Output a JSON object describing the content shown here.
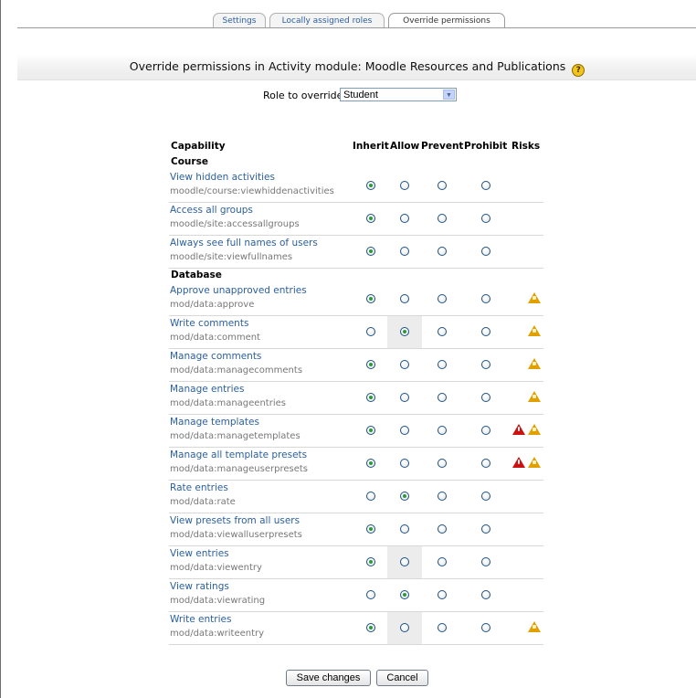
{
  "tabs": [
    {
      "label": "Settings",
      "active": false
    },
    {
      "label": "Locally assigned roles",
      "active": false
    },
    {
      "label": "Override permissions",
      "active": true
    }
  ],
  "header": {
    "title": "Override permissions in Activity module: Moodle Resources and Publications"
  },
  "role": {
    "label": "Role to override",
    "selected": "Student"
  },
  "columns": {
    "capability": "Capability",
    "inherit": "Inherit",
    "allow": "Allow",
    "prevent": "Prevent",
    "prohibit": "Prohibit",
    "risks": "Risks"
  },
  "sections": [
    {
      "name": "Course",
      "rows": [
        {
          "name": "View hidden activities",
          "id": "moodle/course:viewhiddenactivities",
          "selected": "inherit",
          "highlight": false,
          "risks": []
        },
        {
          "name": "Access all groups",
          "id": "moodle/site:accessallgroups",
          "selected": "inherit",
          "highlight": false,
          "risks": []
        },
        {
          "name": "Always see full names of users",
          "id": "moodle/site:viewfullnames",
          "selected": "inherit",
          "highlight": false,
          "risks": []
        }
      ]
    },
    {
      "name": "Database",
      "rows": [
        {
          "name": "Approve unapproved entries",
          "id": "mod/data:approve",
          "selected": "inherit",
          "highlight": false,
          "risks": [
            "spam"
          ]
        },
        {
          "name": "Write comments",
          "id": "mod/data:comment",
          "selected": "allow",
          "highlight": true,
          "risks": [
            "spam"
          ]
        },
        {
          "name": "Manage comments",
          "id": "mod/data:managecomments",
          "selected": "inherit",
          "highlight": false,
          "risks": [
            "spam"
          ]
        },
        {
          "name": "Manage entries",
          "id": "mod/data:manageentries",
          "selected": "inherit",
          "highlight": false,
          "risks": [
            "spam"
          ]
        },
        {
          "name": "Manage templates",
          "id": "mod/data:managetemplates",
          "selected": "inherit",
          "highlight": false,
          "risks": [
            "xss",
            "spam"
          ]
        },
        {
          "name": "Manage all template presets",
          "id": "mod/data:manageuserpresets",
          "selected": "inherit",
          "highlight": false,
          "risks": [
            "xss",
            "spam"
          ]
        },
        {
          "name": "Rate entries",
          "id": "mod/data:rate",
          "selected": "allow",
          "highlight": false,
          "risks": []
        },
        {
          "name": "View presets from all users",
          "id": "mod/data:viewalluserpresets",
          "selected": "inherit",
          "highlight": false,
          "risks": []
        },
        {
          "name": "View entries",
          "id": "mod/data:viewentry",
          "selected": "inherit",
          "highlight": true,
          "risks": []
        },
        {
          "name": "View ratings",
          "id": "mod/data:viewrating",
          "selected": "allow",
          "highlight": false,
          "risks": []
        },
        {
          "name": "Write entries",
          "id": "mod/data:writeentry",
          "selected": "inherit",
          "highlight": true,
          "risks": [
            "spam"
          ]
        }
      ]
    }
  ],
  "buttons": {
    "save": "Save changes",
    "cancel": "Cancel"
  },
  "colors": {
    "link": "#2a5fa0",
    "risk_spam": "#e0a000",
    "risk_xss": "#cc1111",
    "radio_dot": "#2a9a3a"
  }
}
